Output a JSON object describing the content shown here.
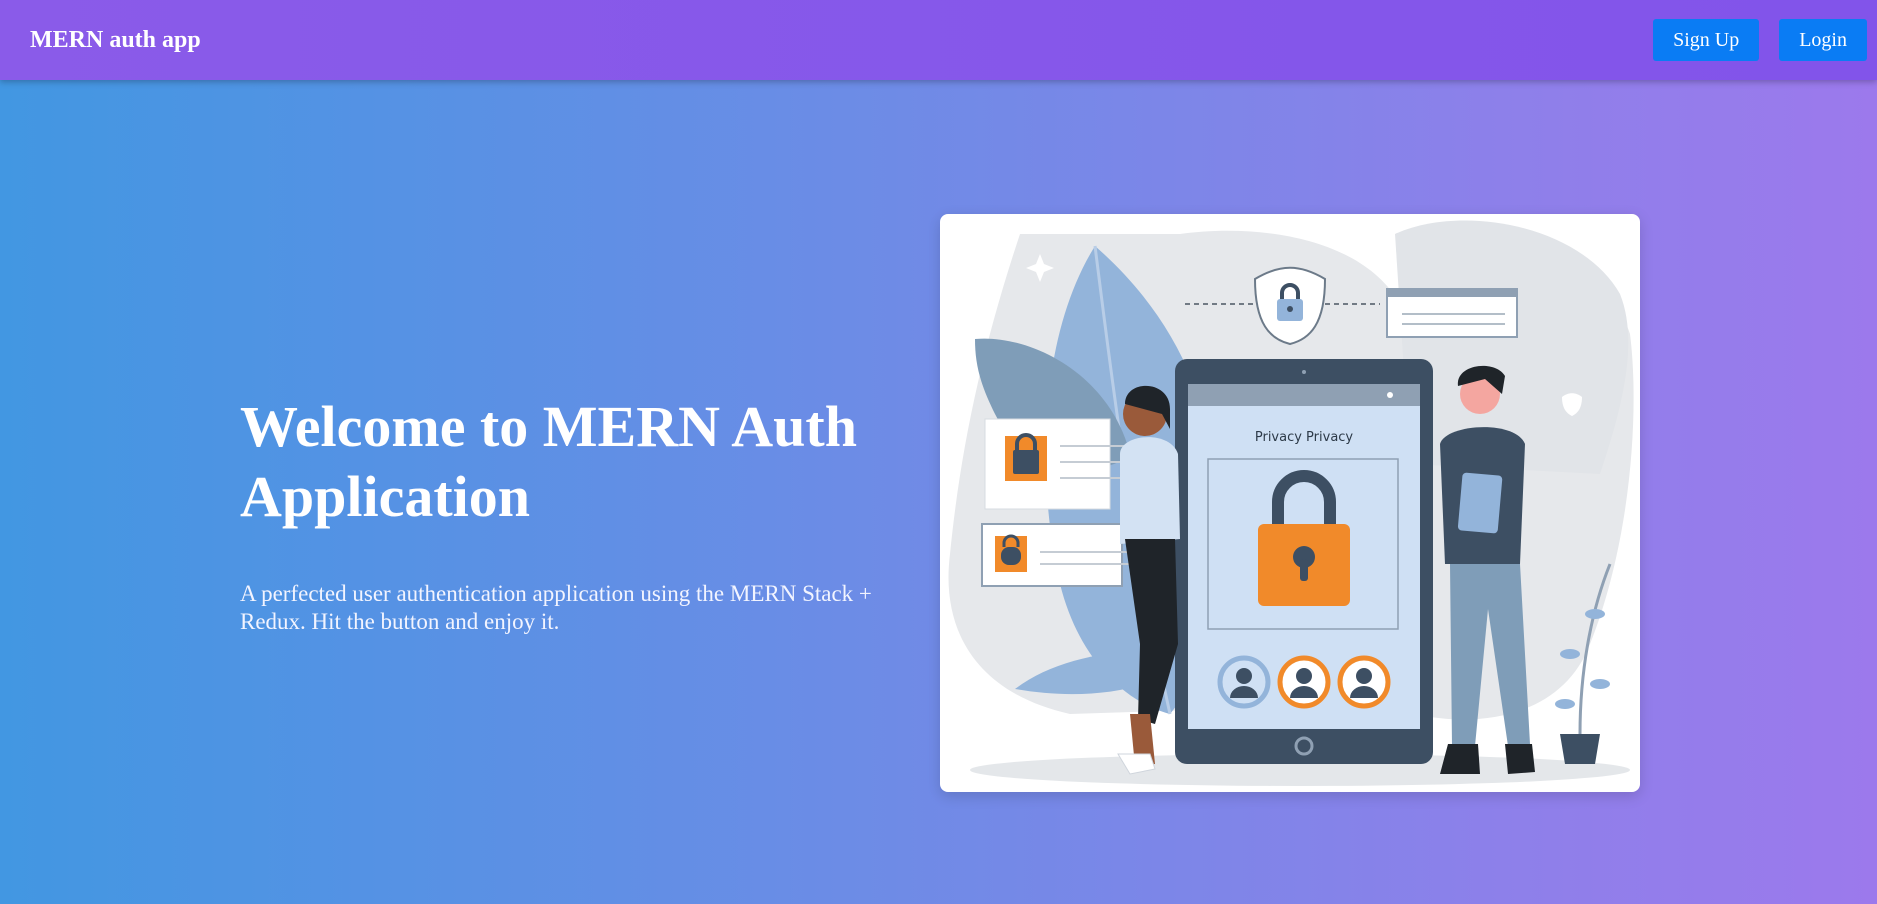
{
  "navbar": {
    "brand": "MERN auth app",
    "signup_label": "Sign Up",
    "login_label": "Login"
  },
  "hero": {
    "title": "Welcome to MERN Auth Application",
    "description": "A perfected user authentication application using the MERN Stack + Redux. Hit the button and enjoy it."
  },
  "illustration": {
    "screen_title": "Privacy Privacy",
    "icons": [
      "lock-icon",
      "shield-lock-icon",
      "user-avatar-icon"
    ]
  },
  "colors": {
    "navbar_bg": "#8556ea",
    "button_bg": "#0a7cf4",
    "accent_orange": "#f18a2a",
    "page_gradient_start": "#4297e2",
    "page_gradient_end": "#9c79ec"
  }
}
